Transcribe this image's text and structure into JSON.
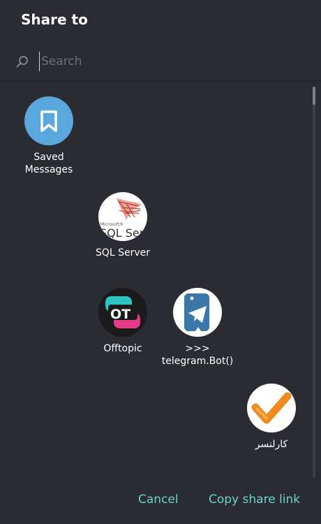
{
  "dialog": {
    "title": "Share to"
  },
  "search": {
    "placeholder": "Search",
    "value": ""
  },
  "chats": [
    {
      "name": "Saved\nMessages",
      "icon": "bookmark-icon",
      "color": "#5aa7de"
    },
    {
      "name": "SQL Server",
      "icon": "sql-server-logo",
      "color": "#ffffff"
    },
    {
      "name": "Offtopic",
      "icon": "offtopic-logo",
      "color": "#1b1b1b"
    },
    {
      "name": ">>>\ntelegram.Bot()",
      "icon": "python-telegram-logo",
      "color": "#ffffff"
    },
    {
      "name": "کارلنسر",
      "icon": "karlancer-logo",
      "color": "#ffffff"
    }
  ],
  "footer": {
    "cancel_label": "Cancel",
    "copy_link_label": "Copy share link"
  },
  "colors": {
    "background": "#2a2c32",
    "accent": "#6ad1c8",
    "saved_messages": "#5aa7de"
  }
}
